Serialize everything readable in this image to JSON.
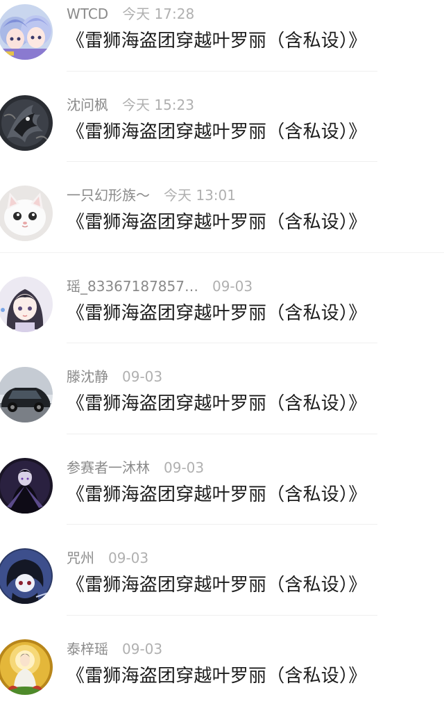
{
  "posts": [
    {
      "user": "WTCD",
      "time": "今天 17:28",
      "title": "《雷狮海盗团穿越叶罗丽（含私设）》",
      "avatar_icon": "anime-duo-avatar"
    },
    {
      "user": "沈问枫",
      "time": "今天 15:23",
      "title": "《雷狮海盗团穿越叶罗丽（含私设）》",
      "avatar_icon": "dark-dragon-avatar"
    },
    {
      "user": "一只幻形族～",
      "time": "今天 13:01",
      "title": "《雷狮海盗团穿越叶罗丽（含私设）》",
      "avatar_icon": "white-kitten-avatar"
    },
    {
      "user": "瑶_83367187857…",
      "time": "09-03",
      "title": "《雷狮海盗团穿越叶罗丽（含私设）》",
      "avatar_icon": "anime-girl-avatar"
    },
    {
      "user": "滕沈静",
      "time": "09-03",
      "title": "《雷狮海盗团穿越叶罗丽（含私设）》",
      "avatar_icon": "car-avatar"
    },
    {
      "user": "参赛者一沐林",
      "time": "09-03",
      "title": "《雷狮海盗团穿越叶罗丽（含私设）》",
      "avatar_icon": "dark-figure-avatar"
    },
    {
      "user": "咒州",
      "time": "09-03",
      "title": "《雷狮海盗团穿越叶罗丽（含私设）》",
      "avatar_icon": "chibi-dark-avatar"
    },
    {
      "user": "泰梓瑶",
      "time": "09-03",
      "title": "《雷狮海盗团穿越叶罗丽（含私设）》",
      "avatar_icon": "guanyin-avatar"
    }
  ]
}
